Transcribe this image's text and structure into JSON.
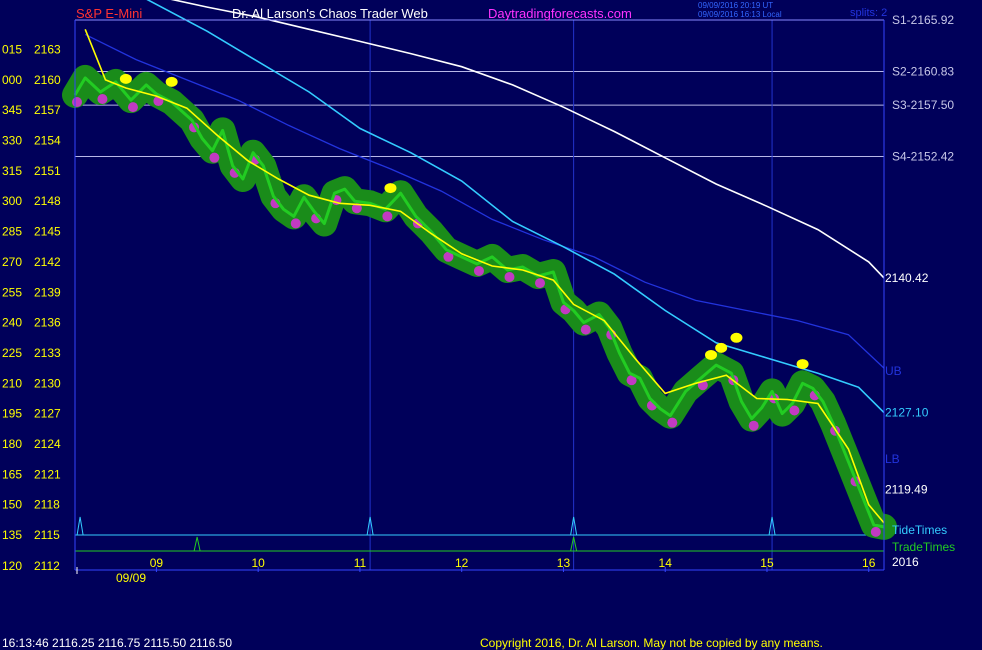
{
  "header": {
    "symbol": "S&P E-Mini",
    "site_title": "Dr. Al Larson's Chaos Trader Web",
    "site_link": "Daytradingforecasts.com",
    "utc_stamp": "09/09/2016 20:19 UT",
    "local_stamp": "09/09/2016 16:13 Local",
    "corner": "splits: 2"
  },
  "footer": {
    "quote": "16:13:46  2116.25 2116.75 2115.50 2116.50",
    "copyright": "Copyright 2016, Dr. Al Larson. May not be copied by any means."
  },
  "colors": {
    "background": "#00005a",
    "price_green": "#22cc22",
    "band_green": "#1a8c1a",
    "magenta": "#c23ac2",
    "yellow": "#ffff00",
    "white_ma": "#ffffff",
    "cyan_ma": "#33ccff",
    "blue_ma": "#2233dd",
    "tide": "#33ccff",
    "trade": "#22cc22"
  },
  "chart_data": {
    "type": "line",
    "title": "S&P E-Mini",
    "x_ticks": [
      "09",
      "10",
      "11",
      "12",
      "13",
      "14",
      "15",
      "16"
    ],
    "x_date": "09/09",
    "y_ticks": [
      {
        "left": "015",
        "price": 2163
      },
      {
        "left": "000",
        "price": 2160
      },
      {
        "left": "345",
        "price": 2157
      },
      {
        "left": "330",
        "price": 2154
      },
      {
        "left": "315",
        "price": 2151
      },
      {
        "left": "300",
        "price": 2148
      },
      {
        "left": "285",
        "price": 2145
      },
      {
        "left": "270",
        "price": 2142
      },
      {
        "left": "255",
        "price": 2139
      },
      {
        "left": "240",
        "price": 2136
      },
      {
        "left": "225",
        "price": 2133
      },
      {
        "left": "210",
        "price": 2130
      },
      {
        "left": "195",
        "price": 2127
      },
      {
        "left": "180",
        "price": 2124
      },
      {
        "left": "165",
        "price": 2121
      },
      {
        "left": "150",
        "price": 2118
      },
      {
        "left": "135",
        "price": 2115
      },
      {
        "left": "120",
        "price": 2112
      }
    ],
    "ylim": [
      2112,
      2165.92
    ],
    "xlim": [
      8.2,
      16.15
    ],
    "support_levels": [
      {
        "label": "S1-2165.92",
        "value": 2165.92
      },
      {
        "label": "S2-2160.83",
        "value": 2160.83
      },
      {
        "label": "S3-2157.50",
        "value": 2157.5
      },
      {
        "label": "S4-2152.42",
        "value": 2152.42
      }
    ],
    "right_labels": [
      {
        "text": "2140.42",
        "value": 2140.42,
        "color": "#ffffff"
      },
      {
        "text": "UB",
        "value": 2131.2,
        "color": "#2233dd"
      },
      {
        "text": "2127.10",
        "value": 2127.1,
        "color": "#33ccff"
      },
      {
        "text": "LB",
        "value": 2122.5,
        "color": "#2233dd"
      },
      {
        "text": "2119.49",
        "value": 2119.49,
        "color": "#ffffff"
      }
    ],
    "tide_label": "TideTimes",
    "trade_label": "TradeTimes",
    "year_label": "2016",
    "vertical_markers": [
      11.1,
      13.1,
      15.05
    ],
    "tide_times": [
      8.25,
      11.1,
      13.1,
      15.05
    ],
    "trade_times": [
      9.4,
      13.1
    ],
    "series": [
      {
        "name": "price",
        "x": [
          8.2,
          8.3,
          8.45,
          8.6,
          8.75,
          8.9,
          9.0,
          9.15,
          9.35,
          9.45,
          9.55,
          9.65,
          9.75,
          9.85,
          9.95,
          10.05,
          10.15,
          10.25,
          10.35,
          10.45,
          10.55,
          10.65,
          10.75,
          10.85,
          10.95,
          11.1,
          11.25,
          11.4,
          11.55,
          11.7,
          11.85,
          12.0,
          12.15,
          12.3,
          12.45,
          12.6,
          12.75,
          12.9,
          13.0,
          13.1,
          13.2,
          13.35,
          13.45,
          13.55,
          13.65,
          13.75,
          13.85,
          13.95,
          14.05,
          14.2,
          14.35,
          14.5,
          14.65,
          14.75,
          14.85,
          14.95,
          15.05,
          15.15,
          15.25,
          15.35,
          15.45,
          15.55,
          15.65,
          15.75,
          15.85,
          15.95,
          16.05,
          16.15
        ],
        "y": [
          2158.5,
          2160.2,
          2158.8,
          2159.8,
          2158.0,
          2159.5,
          2158.6,
          2157.8,
          2156.0,
          2154.2,
          2153.0,
          2155.0,
          2151.5,
          2150.2,
          2152.8,
          2151.5,
          2148.5,
          2147.2,
          2146.5,
          2148.4,
          2147.0,
          2145.8,
          2148.8,
          2149.2,
          2148.0,
          2147.8,
          2147.2,
          2148.8,
          2146.5,
          2145.0,
          2143.2,
          2142.5,
          2141.8,
          2142.5,
          2141.2,
          2141.5,
          2140.6,
          2141.0,
          2138.0,
          2137.2,
          2136.0,
          2136.8,
          2135.5,
          2133.0,
          2131.0,
          2130.5,
          2128.5,
          2127.5,
          2126.8,
          2129.2,
          2130.5,
          2131.8,
          2131.0,
          2128.2,
          2126.5,
          2127.6,
          2129.2,
          2127.0,
          2128.0,
          2130.0,
          2129.5,
          2128.2,
          2126.0,
          2123.5,
          2121.0,
          2118.5,
          2116.0,
          2115.8
        ]
      },
      {
        "name": "white-average",
        "x": [
          8.9,
          9.5,
          10.0,
          10.5,
          11.0,
          11.5,
          12.0,
          12.5,
          13.0,
          13.5,
          14.0,
          14.5,
          15.0,
          15.5,
          16.0,
          16.15
        ],
        "y": [
          2168.5,
          2167.2,
          2166.2,
          2165.0,
          2163.8,
          2162.6,
          2161.3,
          2159.5,
          2157.3,
          2154.9,
          2152.3,
          2149.7,
          2147.5,
          2145.2,
          2142.0,
          2140.42
        ]
      },
      {
        "name": "cyan-average",
        "x": [
          8.9,
          9.5,
          10.0,
          10.5,
          11.0,
          11.5,
          12.0,
          12.5,
          13.0,
          13.5,
          14.0,
          14.5,
          15.0,
          15.5,
          15.9,
          16.15
        ],
        "y": [
          2168.0,
          2164.8,
          2161.8,
          2158.8,
          2155.2,
          2152.8,
          2150.0,
          2146.0,
          2143.5,
          2140.8,
          2137.2,
          2134.0,
          2132.5,
          2131.0,
          2129.6,
          2127.1
        ]
      },
      {
        "name": "blue-average",
        "x": [
          8.3,
          8.8,
          9.3,
          9.8,
          10.3,
          10.8,
          11.3,
          11.8,
          12.3,
          12.8,
          13.3,
          13.8,
          14.3,
          14.8,
          15.3,
          15.8,
          16.15
        ],
        "y": [
          2164.5,
          2162.0,
          2160.0,
          2158.0,
          2155.5,
          2153.2,
          2151.2,
          2149.0,
          2146.2,
          2144.2,
          2142.5,
          2140.0,
          2138.2,
          2137.2,
          2136.2,
          2134.8,
          2131.5
        ]
      },
      {
        "name": "yellow-average",
        "x": [
          8.3,
          8.5,
          8.7,
          9.0,
          9.3,
          9.6,
          9.9,
          10.2,
          10.5,
          10.8,
          11.1,
          11.4,
          11.7,
          12.0,
          12.3,
          12.6,
          12.9,
          13.1,
          13.4,
          13.7,
          14.0,
          14.3,
          14.6,
          14.9,
          15.2,
          15.5,
          15.8,
          16.0,
          16.15
        ],
        "y": [
          2165.0,
          2160.0,
          2159.2,
          2158.4,
          2157.2,
          2154.5,
          2152.0,
          2150.2,
          2148.6,
          2147.8,
          2147.6,
          2147.0,
          2144.8,
          2142.8,
          2141.6,
          2141.2,
          2140.2,
          2137.8,
          2136.2,
          2132.5,
          2129.0,
          2130.0,
          2130.8,
          2128.5,
          2128.4,
          2128.0,
          2123.5,
          2118.0,
          2116.2
        ]
      }
    ],
    "yellow_dots": [
      {
        "x": 8.7,
        "y": 2160.1
      },
      {
        "x": 9.15,
        "y": 2159.8
      },
      {
        "x": 11.3,
        "y": 2149.3
      },
      {
        "x": 14.45,
        "y": 2132.8
      },
      {
        "x": 14.55,
        "y": 2133.5
      },
      {
        "x": 14.7,
        "y": 2134.5
      },
      {
        "x": 15.35,
        "y": 2131.9
      }
    ]
  }
}
